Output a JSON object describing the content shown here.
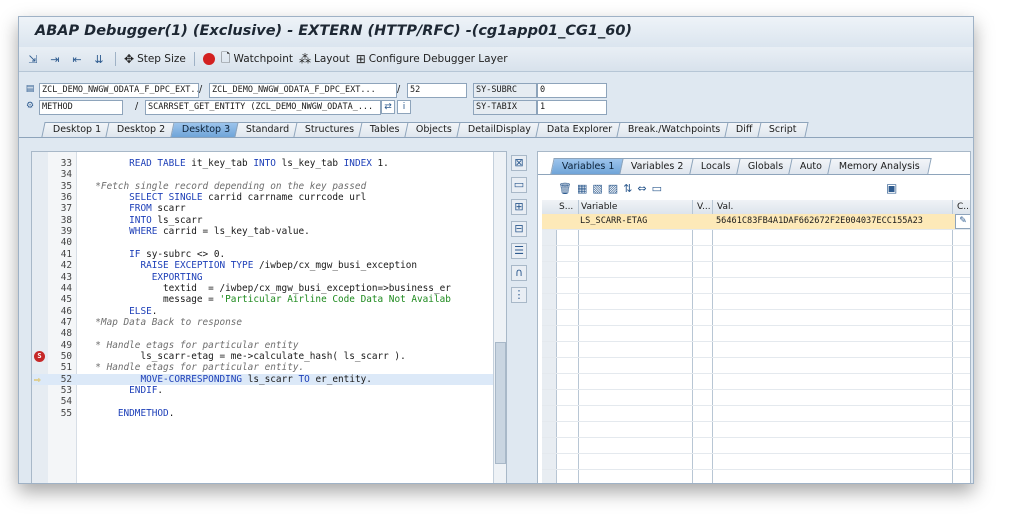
{
  "window": {
    "title": "ABAP Debugger(1)  (Exclusive) - EXTERN (HTTP/RFC) -(cg1app01_CG1_60)"
  },
  "toolbar": {
    "step_size": "Step Size",
    "watchpoint": "Watchpoint",
    "layout": "Layout",
    "configure": "Configure Debugger Layer"
  },
  "header": {
    "program": "ZCL_DEMO_NWGW_ODATA_F_DPC_EXT...",
    "include": "ZCL_DEMO_NWGW_ODATA_F_DPC_EXT...",
    "line": "52",
    "sy_subrc_label": "SY-SUBRC",
    "sy_subrc_value": "0",
    "type": "METHOD",
    "method": "SCARRSET_GET_ENTITY (ZCL_DEMO_NWGW_ODATA_...",
    "sy_tabix_label": "SY-TABIX",
    "sy_tabix_value": "1"
  },
  "desktop_tabs": [
    "Desktop 1",
    "Desktop 2",
    "Desktop 3",
    "Standard",
    "Structures",
    "Tables",
    "Objects",
    "DetailDisplay",
    "Data Explorer",
    "Break./Watchpoints",
    "Diff",
    "Script"
  ],
  "code": {
    "lines": [
      {
        "n": "33",
        "t": "        READ TABLE it_key_tab INTO ls_key_tab INDEX 1."
      },
      {
        "n": "34",
        "t": ""
      },
      {
        "n": "35",
        "t": "  *Fetch single record depending on the key passed"
      },
      {
        "n": "36",
        "t": "        SELECT SINGLE carrid carrname currcode url"
      },
      {
        "n": "37",
        "t": "        FROM scarr"
      },
      {
        "n": "38",
        "t": "        INTO ls_scarr"
      },
      {
        "n": "39",
        "t": "        WHERE carrid = ls_key_tab-value."
      },
      {
        "n": "40",
        "t": ""
      },
      {
        "n": "41",
        "t": "        IF sy-subrc <> 0."
      },
      {
        "n": "42",
        "t": "          RAISE EXCEPTION TYPE /iwbep/cx_mgw_busi_exception"
      },
      {
        "n": "43",
        "t": "            EXPORTING"
      },
      {
        "n": "44",
        "t": "              textid  = /iwbep/cx_mgw_busi_exception=>business_er"
      },
      {
        "n": "45",
        "t": "              message = 'Particular Airline Code Data Not Availab"
      },
      {
        "n": "46",
        "t": "        ELSE."
      },
      {
        "n": "47",
        "t": "  *Map Data Back to response"
      },
      {
        "n": "48",
        "t": ""
      },
      {
        "n": "49",
        "t": "  * Handle etags for particular entity"
      },
      {
        "n": "50",
        "t": "          ls_scarr-etag = me->calculate_hash( ls_scarr )."
      },
      {
        "n": "51",
        "t": "  * Handle etags for particular entity."
      },
      {
        "n": "52",
        "t": "          MOVE-CORRESPONDING ls_scarr TO er_entity."
      },
      {
        "n": "53",
        "t": "        ENDIF."
      },
      {
        "n": "54",
        "t": ""
      },
      {
        "n": "55",
        "t": "      ENDMETHOD."
      }
    ]
  },
  "var_tabs": [
    "Variables 1",
    "Variables 2",
    "Locals",
    "Globals",
    "Auto",
    "Memory Analysis"
  ],
  "grid": {
    "headers": [
      "S...",
      "Variable",
      "V...",
      "Val.",
      "C..."
    ],
    "rows": [
      {
        "variable": "LS_SCARR-ETAG",
        "value": "56461C83FB4A1DAF662672F2E004037ECC155A23"
      }
    ]
  }
}
